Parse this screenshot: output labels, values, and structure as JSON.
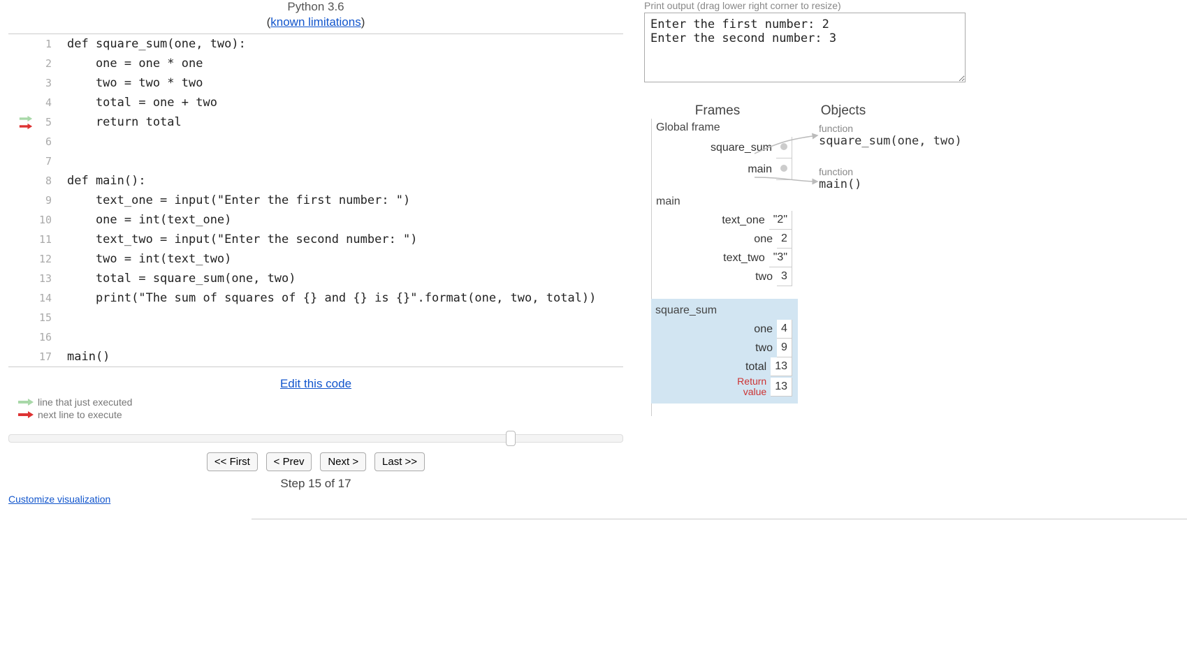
{
  "header": {
    "language": "Python 3.6",
    "limitations_label": "known limitations"
  },
  "code": {
    "lines": [
      "def square_sum(one, two):",
      "    one = one * one",
      "    two = two * two",
      "    total = one + two",
      "    return total",
      "",
      "",
      "def main():",
      "    text_one = input(\"Enter the first number: \")",
      "    one = int(text_one)",
      "    text_two = input(\"Enter the second number: \")",
      "    two = int(text_two)",
      "    total = square_sum(one, two)",
      "    print(\"The sum of squares of {} and {} is {}\".format(one, two, total))",
      "",
      "",
      "main()"
    ],
    "just_executed_line": 5,
    "next_line": 5
  },
  "controls": {
    "edit_label": "Edit this code",
    "legend_prev": "line that just executed",
    "legend_next": "next line to execute",
    "first": "<< First",
    "prev": "< Prev",
    "next": "Next >",
    "last": "Last >>",
    "step_label": "Step 15 of 17",
    "customize": "Customize visualization"
  },
  "output": {
    "label": "Print output (drag lower right corner to resize)",
    "text": "Enter the first number: 2\nEnter the second number: 3"
  },
  "viz": {
    "frames_header": "Frames",
    "objects_header": "Objects",
    "global": {
      "title": "Global frame",
      "vars": [
        {
          "name": "square_sum",
          "ref": true
        },
        {
          "name": "main",
          "ref": true
        }
      ]
    },
    "main_frame": {
      "title": "main",
      "vars": [
        {
          "name": "text_one",
          "value": "\"2\""
        },
        {
          "name": "one",
          "value": "2"
        },
        {
          "name": "text_two",
          "value": "\"3\""
        },
        {
          "name": "two",
          "value": "3"
        }
      ]
    },
    "sqsum_frame": {
      "title": "square_sum",
      "vars": [
        {
          "name": "one",
          "value": "4"
        },
        {
          "name": "two",
          "value": "9"
        },
        {
          "name": "total",
          "value": "13"
        }
      ],
      "return_label": "Return\nvalue",
      "return_value": "13"
    },
    "objects": [
      {
        "label": "function",
        "text": "square_sum(one, two)"
      },
      {
        "label": "function",
        "text": "main()"
      }
    ]
  }
}
